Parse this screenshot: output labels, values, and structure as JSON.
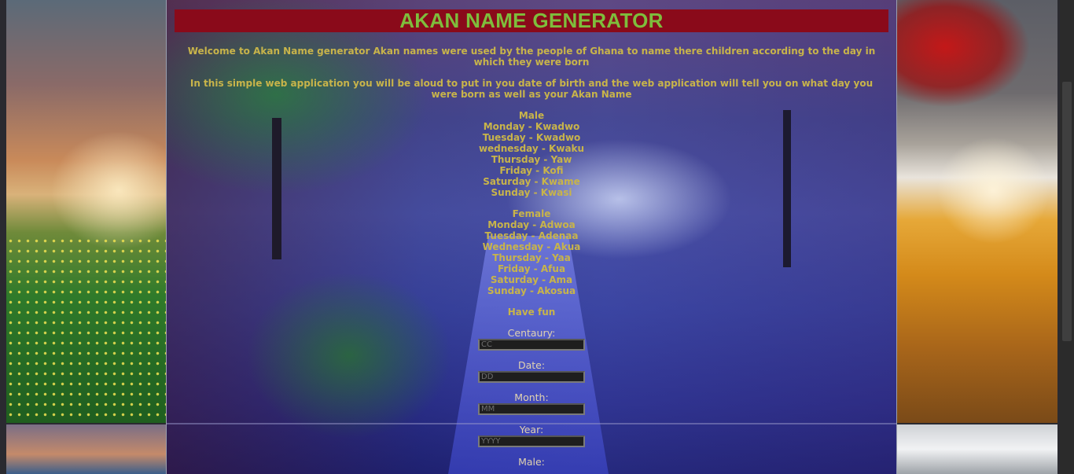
{
  "app": {
    "title": "AKAN NAME GENERATOR",
    "intro_1": "Welcome to Akan Name generator Akan names were used by the people of Ghana to name there children according to the day in which they were born",
    "intro_2": "In this simple web application you will be aloud to put in you date of birth and the web application will tell you on what day you were born as well as your Akan Name"
  },
  "male": {
    "heading": "Male",
    "items": [
      "Monday - Kwadwo",
      "Tuesday - Kwadwo",
      "wednesday - Kwaku",
      "Thursday - Yaw",
      "Friday - Kofi",
      "Saturday - Kwame",
      "Sunday - Kwasi"
    ]
  },
  "female": {
    "heading": "Female",
    "items": [
      "Monday - Adwoa",
      "Tuesday - Adenaa",
      "Wednesday - Akua",
      "Thursday - Yaa",
      "Friday - Afua",
      "Saturday - Ama",
      "Sunday - Akosua"
    ]
  },
  "closing": "Have fun",
  "form": {
    "century": {
      "label": "Centaury:",
      "placeholder": "CC"
    },
    "date": {
      "label": "Date:",
      "placeholder": "DD"
    },
    "month": {
      "label": "Month:",
      "placeholder": "MM"
    },
    "year": {
      "label": "Year:",
      "placeholder": "YYYY"
    },
    "gender_label_partial": "Male:"
  },
  "colors": {
    "title_bar": "#8a0a1a",
    "title_text": "#7ebd3c",
    "body_text": "#c8b44a"
  }
}
